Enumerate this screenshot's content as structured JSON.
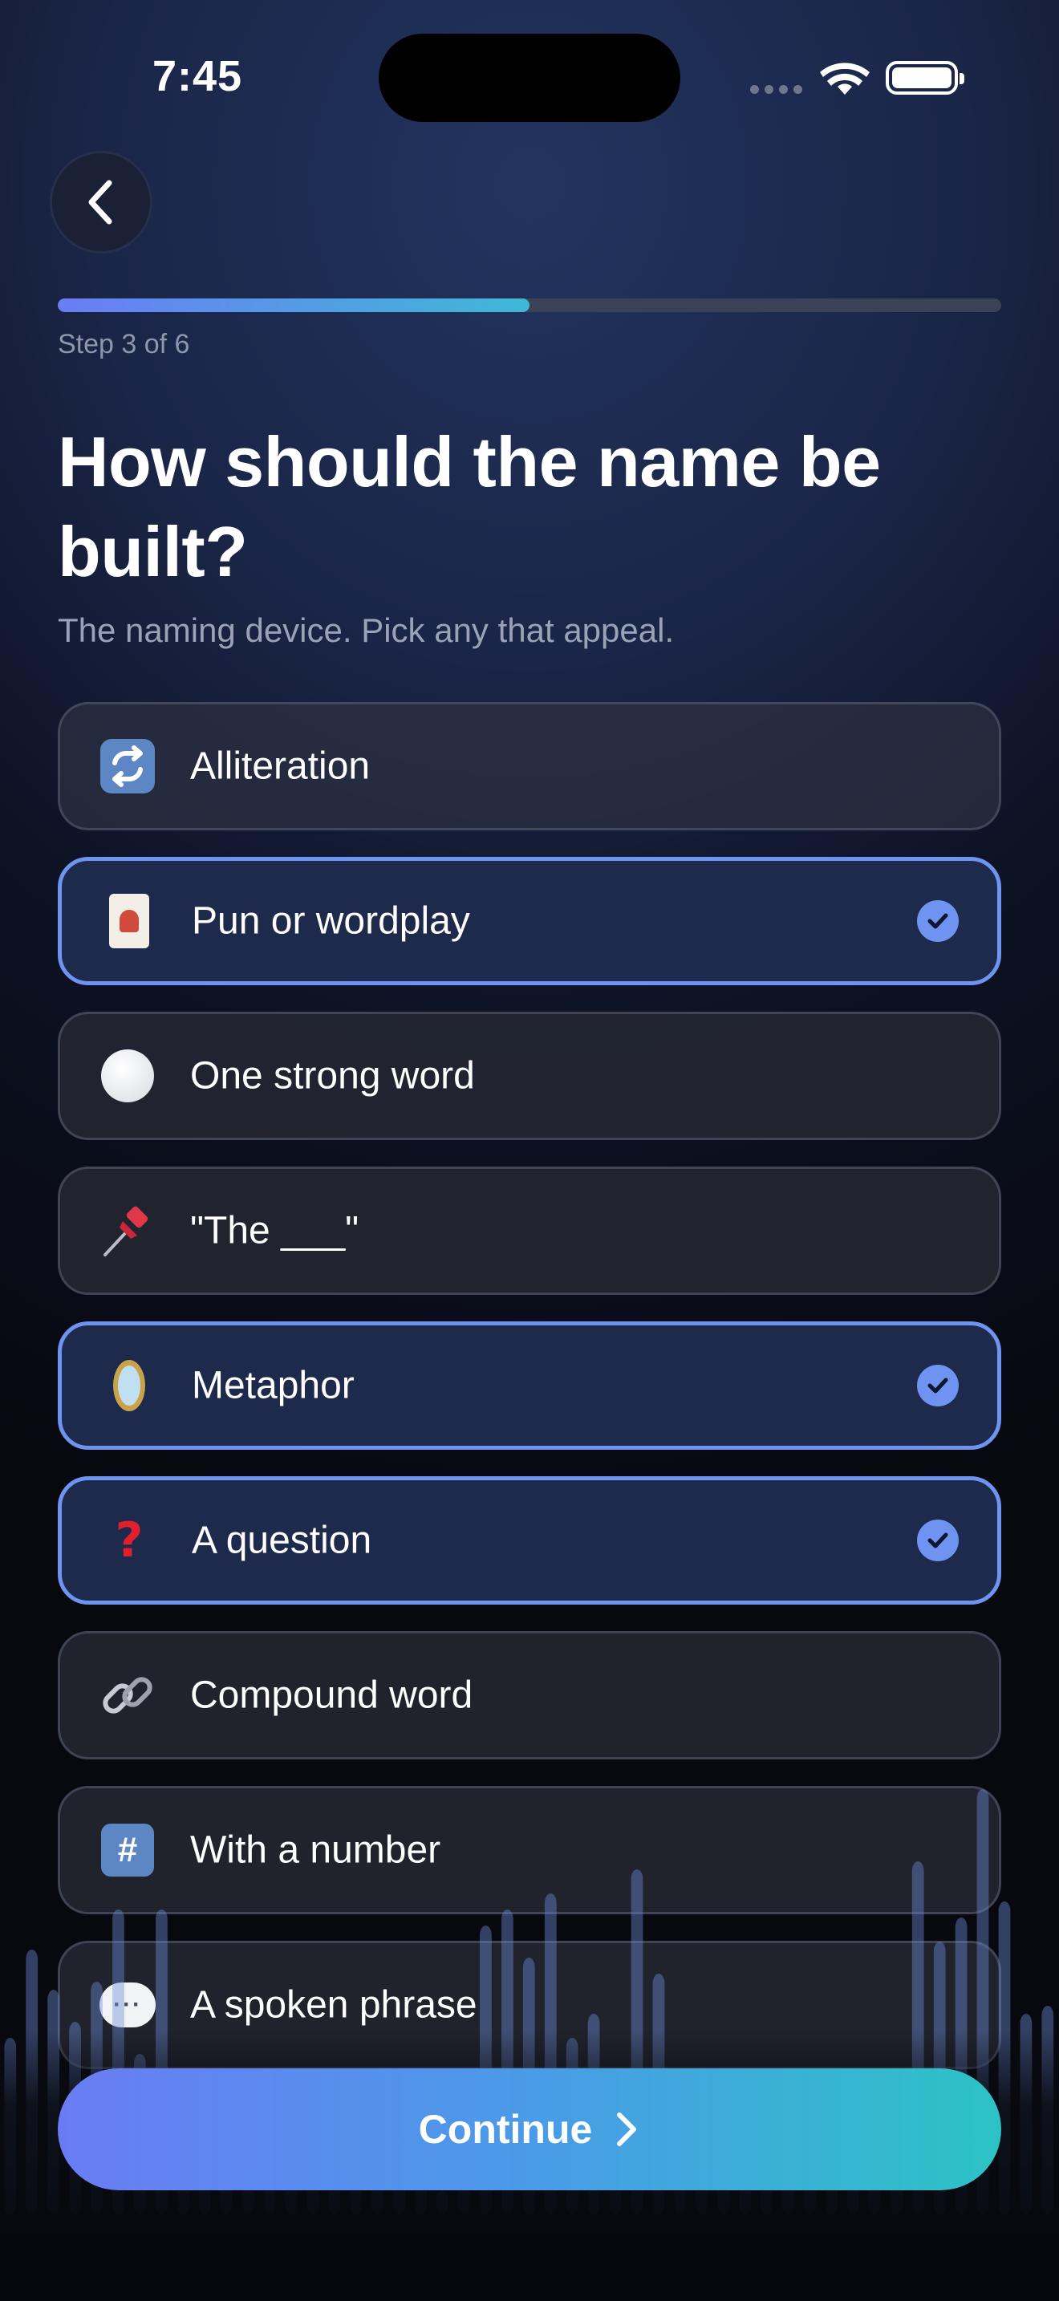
{
  "status_bar": {
    "time": "7:45"
  },
  "navigation": {
    "back_icon": "chevron-left-icon"
  },
  "progress": {
    "step_label": "Step 3 of 6",
    "fraction": 0.5,
    "fill_colors": [
      "#6a7df5",
      "#3fb8d6"
    ]
  },
  "header": {
    "title": "How should the name be built?",
    "subtitle": "The naming device. Pick any that appeal."
  },
  "options": [
    {
      "label": "Alliteration",
      "icon": "repeat-icon",
      "selected": false
    },
    {
      "label": "Pun or wordplay",
      "icon": "joker-card-icon",
      "selected": true
    },
    {
      "label": "One strong word",
      "icon": "white-circle-icon",
      "selected": false
    },
    {
      "label": "\"The ___\"",
      "icon": "pushpin-icon",
      "selected": false
    },
    {
      "label": "Metaphor",
      "icon": "mirror-icon",
      "selected": true
    },
    {
      "label": "A question",
      "icon": "question-mark-icon",
      "selected": true
    },
    {
      "label": "Compound word",
      "icon": "link-icon",
      "selected": false
    },
    {
      "label": "With a number",
      "icon": "hash-icon",
      "selected": false
    },
    {
      "label": "A spoken phrase",
      "icon": "speech-bubble-icon",
      "selected": false
    }
  ],
  "footer": {
    "continue_label": "Continue",
    "continue_icon": "chevron-right-icon"
  },
  "colors": {
    "accent": "#6e93f0",
    "button_gradient_start": "#6a7cf4",
    "button_gradient_end": "#2cc3c5"
  }
}
